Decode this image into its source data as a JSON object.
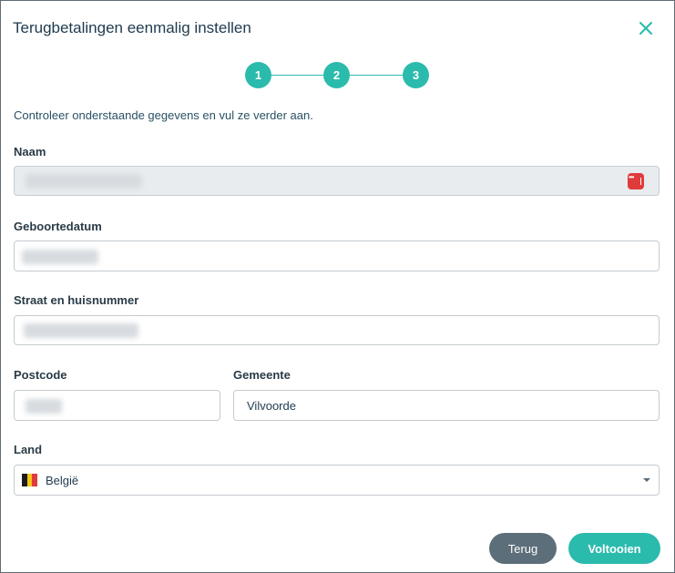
{
  "dialog": {
    "title": "Terugbetalingen eenmalig instellen",
    "close_icon": "close-icon",
    "accent_color": "#2bbbad"
  },
  "stepper": {
    "steps": [
      "1",
      "2",
      "3"
    ]
  },
  "intro": "Controleer onderstaande gegevens en vul ze verder aan.",
  "form": {
    "name": {
      "label": "Naam",
      "value": "",
      "disabled": true,
      "icon": "password-manager-icon"
    },
    "birthdate": {
      "label": "Geboortedatum",
      "value": ""
    },
    "street": {
      "label": "Straat en huisnummer",
      "value": ""
    },
    "postcode": {
      "label": "Postcode",
      "value": ""
    },
    "municipality": {
      "label": "Gemeente",
      "value": "Vilvoorde"
    },
    "country": {
      "label": "Land",
      "selected": "België",
      "icon": "belgium-flag-icon"
    }
  },
  "buttons": {
    "back": "Terug",
    "finish": "Voltooien"
  }
}
